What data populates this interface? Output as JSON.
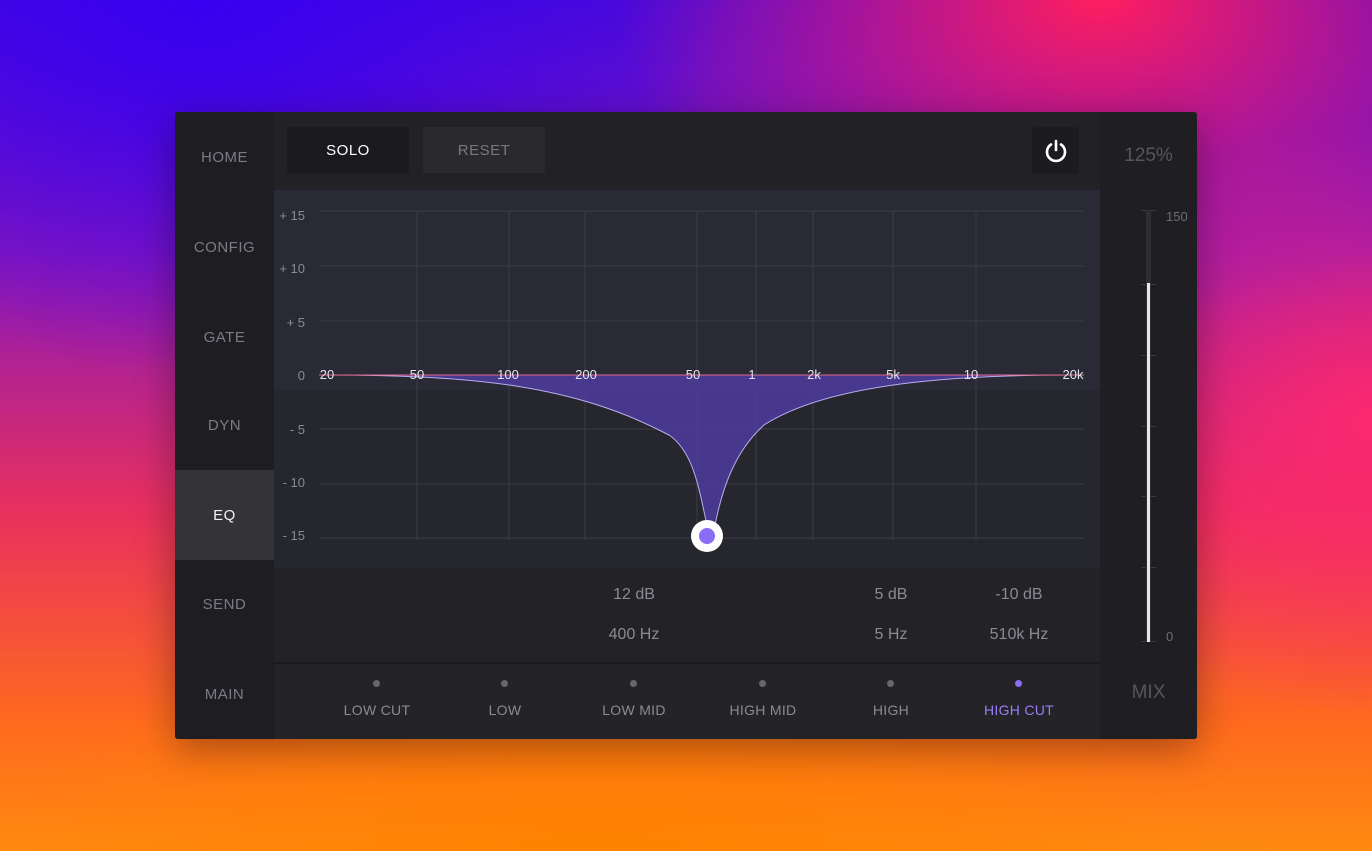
{
  "nav": {
    "items": [
      {
        "label": "HOME"
      },
      {
        "label": "CONFIG"
      },
      {
        "label": "GATE"
      },
      {
        "label": "DYN"
      },
      {
        "label": "EQ",
        "active": true
      },
      {
        "label": "SEND"
      },
      {
        "label": "MAIN"
      }
    ]
  },
  "toolbar": {
    "solo_label": "SOLO",
    "reset_label": "RESET",
    "power_icon": "power-icon"
  },
  "graph": {
    "db_labels": [
      "+ 15",
      "+ 10",
      "+ 5",
      "0",
      "- 5",
      "- 10",
      "- 15"
    ],
    "freq_labels": [
      "20",
      "50",
      "100",
      "200",
      "50",
      "1",
      "2k",
      "5k",
      "10",
      "20k"
    ],
    "curve_color": "#5b44c7",
    "handle_color": "#8a6cf5"
  },
  "params": [
    {
      "gain": "12 dB",
      "freq": "400 Hz"
    },
    {
      "gain": "5 dB",
      "freq": "5 Hz"
    },
    {
      "gain": "-10 dB",
      "freq": "510k Hz"
    }
  ],
  "bands": [
    {
      "label": "LOW CUT"
    },
    {
      "label": "LOW"
    },
    {
      "label": "LOW MID"
    },
    {
      "label": "HIGH MID"
    },
    {
      "label": "HIGH"
    },
    {
      "label": "HIGH CUT",
      "active": true
    }
  ],
  "mix": {
    "percent": "125%",
    "label": "MIX",
    "scale_max": "150",
    "scale_min": "0",
    "level_fraction": 0.83
  }
}
